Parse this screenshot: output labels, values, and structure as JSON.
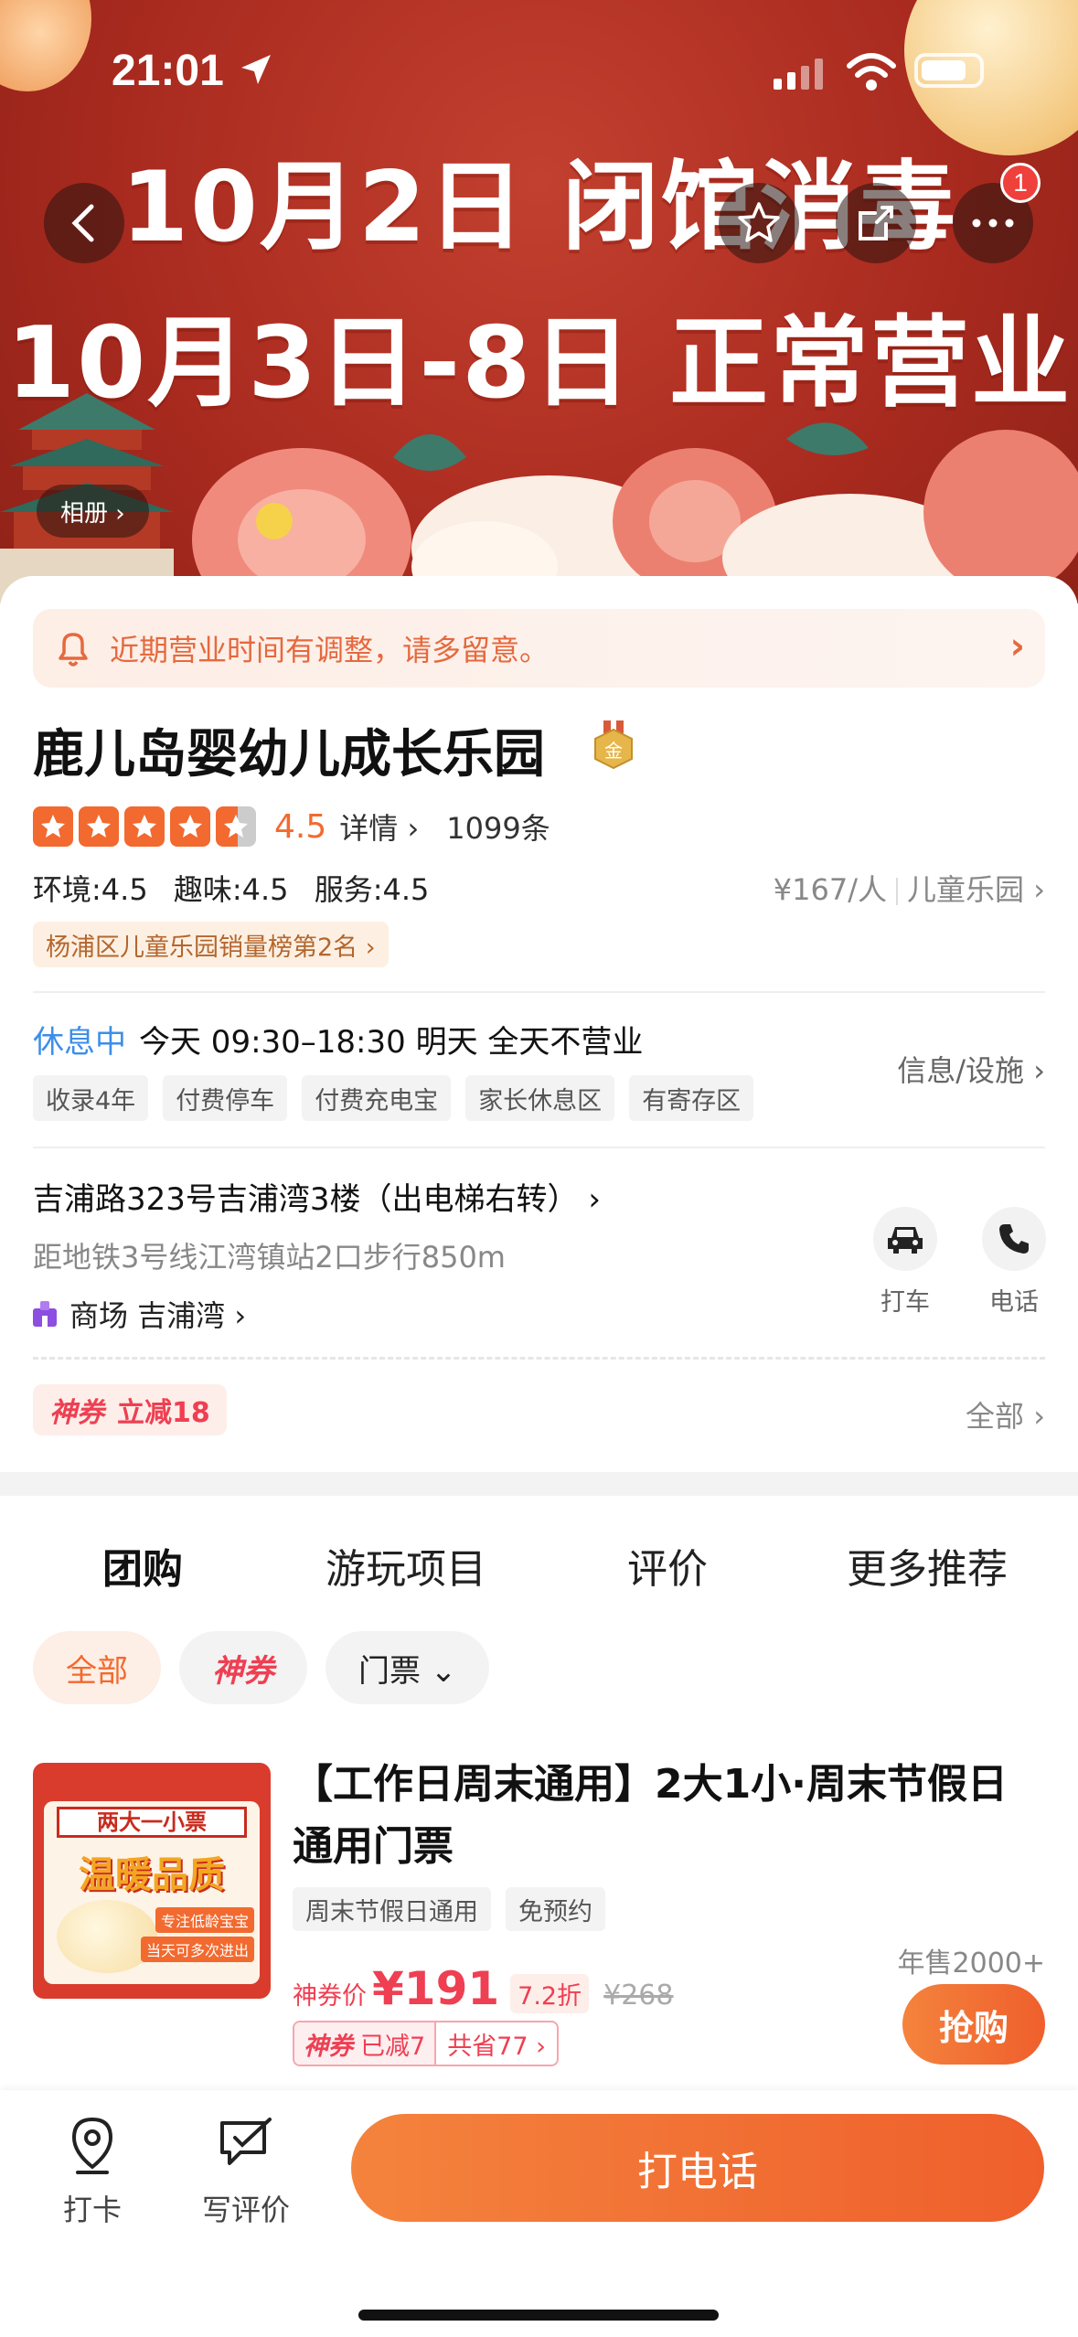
{
  "status_bar": {
    "time": "21:01"
  },
  "hero": {
    "line1": "10月2日 闭馆消毒",
    "line2": "10月3日-8日 正常营业",
    "album_label": "相册 ›",
    "more_badge": "1"
  },
  "notice": {
    "text": "近期营业时间有调整，请多留意。"
  },
  "shop": {
    "name": "鹿儿岛婴幼儿成长乐园",
    "badge_text": "金",
    "rating": "4.5",
    "details_label": "详情 ›",
    "review_count": "1099条",
    "scores": [
      "环境:4.5",
      "趣味:4.5",
      "服务:4.5"
    ],
    "price": "¥167/人",
    "category": "儿童乐园 ›",
    "rank_tag": "杨浦区儿童乐园销量榜第2名 ›"
  },
  "hours": {
    "status": "休息中",
    "text": "今天 09:30–18:30 明天 全天不营业",
    "info_link": "信息/设施 ›",
    "tags": [
      "收录4年",
      "付费停车",
      "付费充电宝",
      "家长休息区",
      "有寄存区"
    ]
  },
  "location": {
    "address": "吉浦路323号吉浦湾3楼（出电梯右转） ›",
    "distance": "距地铁3号线江湾镇站2口步行850m",
    "mall": "商场 吉浦湾 ›",
    "taxi_label": "打车",
    "phone_label": "电话"
  },
  "coupon": {
    "shen": "神券",
    "off": "立减18",
    "all_link": "全部 ›"
  },
  "tabs": [
    "团购",
    "游玩项目",
    "评价",
    "更多推荐"
  ],
  "chips": [
    "全部",
    "神券",
    "门票 ⌄"
  ],
  "deal": {
    "image": {
      "t1": "两大一小票",
      "t2": "温暖品质",
      "t3": "专注低龄宝宝",
      "t4": "当天可多次进出"
    },
    "title": "【工作日周末通用】2大1小·周末节假日通用门票",
    "tags": [
      "周末节假日通用",
      "免预约"
    ],
    "sold": "年售2000+",
    "price_label": "神券价",
    "price": "¥191",
    "discount": "7.2折",
    "original": "¥268",
    "shen": "神券",
    "reduced": "已减7",
    "saved": "共省77 ›",
    "grab_label": "抢购"
  },
  "bottom": {
    "checkin": "打卡",
    "review": "写评价",
    "call": "打电话"
  },
  "colors": {
    "accent": "#f26a2f",
    "coupon_red": "#ef3f52",
    "closed_blue": "#3d8ee8",
    "hero_red": "#a92a1f"
  }
}
